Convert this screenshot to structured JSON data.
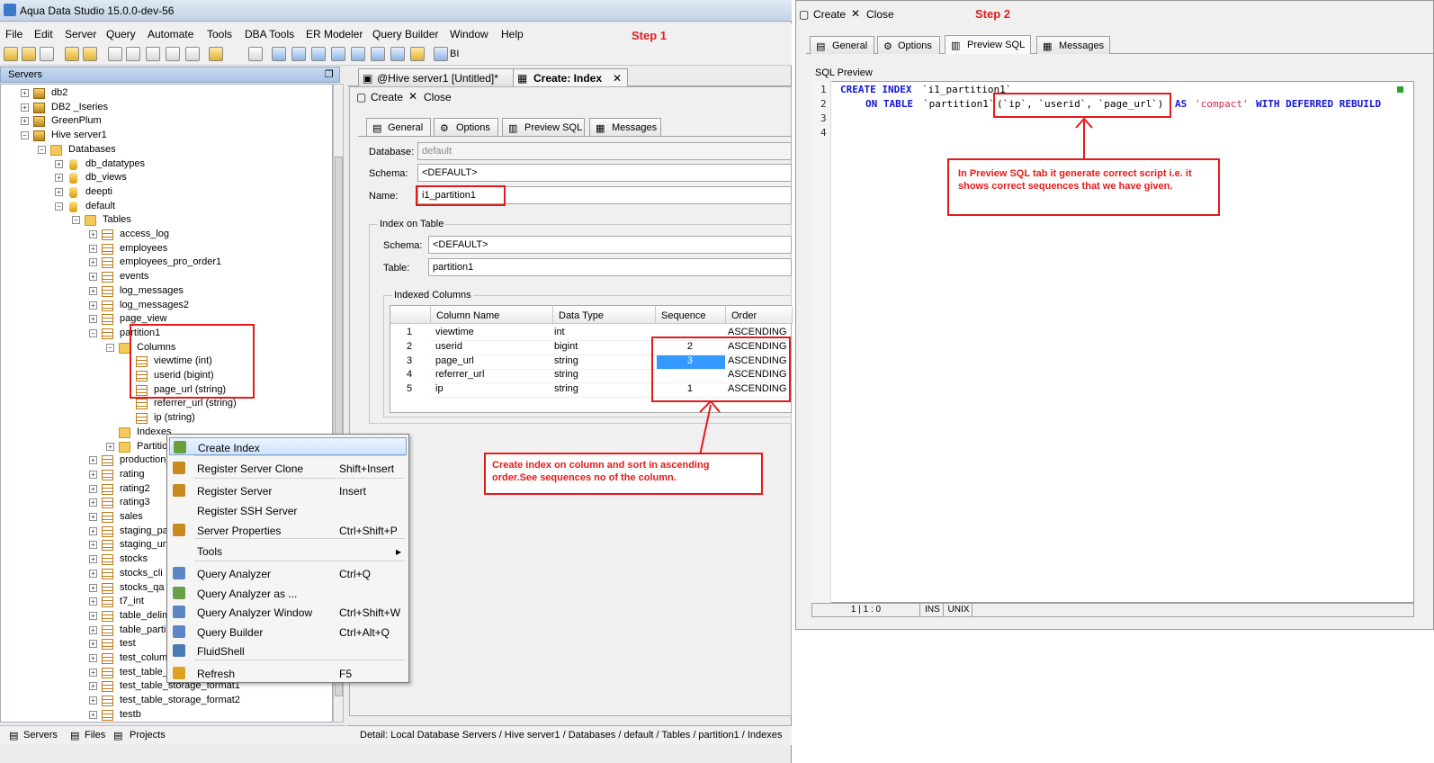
{
  "left_window": {
    "title": "Aqua Data Studio 15.0.0-dev-56",
    "menu": [
      "File",
      "Edit",
      "Server",
      "Query",
      "Automate",
      "Tools",
      "DBA Tools",
      "ER Modeler",
      "Query Builder",
      "Window",
      "Help"
    ],
    "step_label": "Step 1",
    "toolbar_bi": "BI",
    "servers_panel": {
      "title": "Servers",
      "tree": {
        "servers": [
          "db2",
          "DB2 _Iseries",
          "GreenPlum",
          "Hive server1"
        ],
        "databases_label": "Databases",
        "databases": [
          "db_datatypes",
          "db_views",
          "deepti",
          "default"
        ],
        "tables_label": "Tables",
        "tables_before": [
          "access_log",
          "employees",
          "employees_pro_order1",
          "events",
          "log_messages",
          "log_messages2",
          "page_view",
          "partition1"
        ],
        "columns_label": "Columns",
        "columns": [
          "viewtime (int)",
          "userid (bigint)",
          "page_url (string)",
          "referrer_url (string)",
          "ip (string)"
        ],
        "indexes_label": "Indexes",
        "partitions_label": "Partitio",
        "tables_after": [
          "production_",
          "rating",
          "rating2",
          "rating3",
          "sales",
          "staging_par",
          "staging_unp",
          "stocks",
          "stocks_cli",
          "stocks_qa",
          "t7_int",
          "table_delim",
          "table_parti",
          "test",
          "test_column",
          "test_table_",
          "test_table_storage_format1",
          "test_table_storage_format2",
          "testb"
        ]
      },
      "bottom_tabs": [
        "Servers",
        "Files",
        "Projects"
      ]
    },
    "context_menu": [
      {
        "label": "Create Index",
        "shortcut": "",
        "selected": true
      },
      {
        "label": "Register Server Clone",
        "shortcut": "Shift+Insert"
      },
      {
        "label": "Register Server",
        "shortcut": "Insert"
      },
      {
        "label": "Register SSH Server",
        "shortcut": ""
      },
      {
        "label": "Server Properties",
        "shortcut": "Ctrl+Shift+P"
      },
      {
        "label": "Tools",
        "shortcut": "▸"
      },
      {
        "label": "Query Analyzer",
        "shortcut": "Ctrl+Q"
      },
      {
        "label": "Query Analyzer as ...",
        "shortcut": ""
      },
      {
        "label": "Query Analyzer Window",
        "shortcut": "Ctrl+Shift+W"
      },
      {
        "label": "Query Builder",
        "shortcut": "Ctrl+Alt+Q"
      },
      {
        "label": "FluidShell",
        "shortcut": ""
      },
      {
        "label": "Refresh",
        "shortcut": "F5"
      }
    ],
    "doc_tabs": [
      "@Hive server1 [Untitled]*",
      "Create: Index"
    ],
    "editor": {
      "create_label": "Create",
      "close_label": "Close",
      "subtabs": [
        "General",
        "Options",
        "Preview SQL",
        "Messages"
      ],
      "database_label": "Database:",
      "database_value": "default",
      "schema_label": "Schema:",
      "schema_value": "<DEFAULT>",
      "name_label": "Name:",
      "name_value": "i1_partition1",
      "index_on_table_label": "Index on Table",
      "tbl_schema_label": "Schema:",
      "tbl_schema_value": "<DEFAULT>",
      "table_label": "Table:",
      "table_value": "partition1",
      "indexed_columns_label": "Indexed Columns",
      "grid_headers": [
        "Column Name",
        "Data Type",
        "Sequence",
        "Order"
      ],
      "grid_rows": [
        {
          "n": "1",
          "col": "viewtime",
          "type": "int",
          "seq": "",
          "order": "ASCENDING"
        },
        {
          "n": "2",
          "col": "userid",
          "type": "bigint",
          "seq": "2",
          "order": "ASCENDING"
        },
        {
          "n": "3",
          "col": "page_url",
          "type": "string",
          "seq": "3",
          "order": "ASCENDING"
        },
        {
          "n": "4",
          "col": "referrer_url",
          "type": "string",
          "seq": "",
          "order": "ASCENDING"
        },
        {
          "n": "5",
          "col": "ip",
          "type": "string",
          "seq": "1",
          "order": "ASCENDING"
        }
      ]
    },
    "annotation": "Create index on column and sort in ascending order.See sequences no of the column.",
    "detail": "Detail: Local Database Servers / Hive server1 / Databases / default / Tables / partition1 / Indexes"
  },
  "right_window": {
    "create_label": "Create",
    "close_label": "Close",
    "step_label": "Step 2",
    "subtabs": [
      "General",
      "Options",
      "Preview SQL",
      "Messages"
    ],
    "sql_preview_label": "SQL Preview",
    "line_numbers": [
      "1",
      "2",
      "3",
      "4"
    ],
    "sql": {
      "l1_kw": "CREATE INDEX",
      "l1_name": "`i1_partition1`",
      "l2_kw": "ON TABLE",
      "l2_table": "`partition1`",
      "l2_cols": "(`ip`, `userid`, `page_url`)",
      "l2_as": "AS",
      "l2_str": "'compact'",
      "l2_tail": "WITH DEFERRED REBUILD"
    },
    "annotation": "In Preview SQL tab it generate correct script i.e.  it shows correct sequences that we have given.",
    "status": [
      "1 | 1 : 0",
      "INS",
      "UNIX"
    ]
  },
  "colors": {
    "annotation_red": "#e51b1b",
    "sql_keyword": "#1414d8",
    "sql_string": "#e0244a",
    "selection": "#3399ff"
  }
}
